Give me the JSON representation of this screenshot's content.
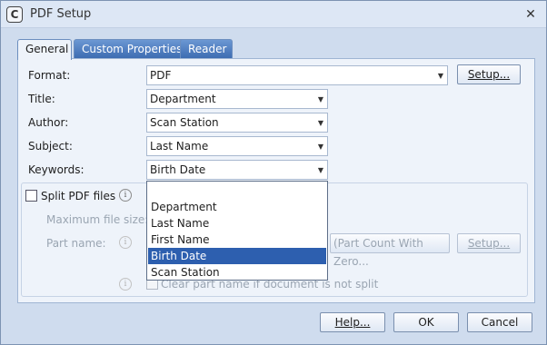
{
  "window": {
    "title": "PDF Setup"
  },
  "tabs": [
    {
      "label": "General"
    },
    {
      "label": "Custom Properties"
    },
    {
      "label": "Reader"
    }
  ],
  "fields": {
    "format": {
      "label": "Format:",
      "value": "PDF"
    },
    "title": {
      "label": "Title:",
      "value": "Department"
    },
    "author": {
      "label": "Author:",
      "value": "Scan Station"
    },
    "subject": {
      "label": "Subject:",
      "value": "Last Name"
    },
    "keywords": {
      "label": "Keywords:",
      "value": "Birth Date"
    }
  },
  "setup_button": "Setup...",
  "split": {
    "checkbox_label": "Split PDF files",
    "max_size_label": "Maximum file size:",
    "part_name_label": "Part name:",
    "part_name_value": "(Part Count With Zero...",
    "setup_label": "Setup...",
    "clear_label": "Clear part name if document is not split"
  },
  "dropdown": {
    "items": [
      "",
      "Department",
      "Last Name",
      "First Name",
      "Birth Date",
      "Scan Station"
    ],
    "selected": "Birth Date"
  },
  "footer": {
    "help": "Help...",
    "ok": "OK",
    "cancel": "Cancel"
  },
  "icons": {
    "app": "app-logo-icon",
    "close": "close-icon",
    "info": "info-icon",
    "dropdown": "chevron-down-icon"
  }
}
